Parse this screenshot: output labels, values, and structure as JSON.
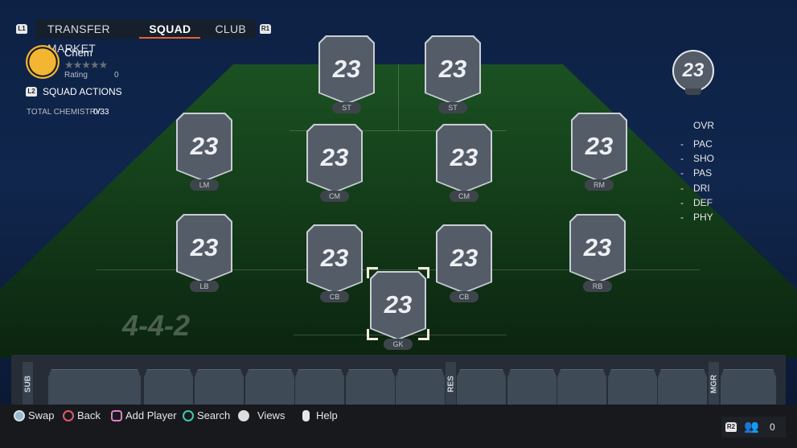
{
  "tabs": {
    "l_button": "L1",
    "r_button": "R1",
    "items": [
      {
        "label": "TRANSFER MARKET"
      },
      {
        "label": "SQUAD",
        "active": true
      },
      {
        "label": "CLUB"
      }
    ]
  },
  "club": {
    "crest": "Kaizer Chiefs",
    "chem_label": "Chem",
    "stars": 0,
    "max_stars": 5,
    "rating_label": "Rating",
    "rating_value": "0"
  },
  "squad_actions": {
    "button": "L2",
    "label": "SQUAD ACTIONS"
  },
  "total_chemistry": {
    "label": "TOTAL CHEMISTRY",
    "value": "0/33"
  },
  "formation": "4-4-2",
  "players": [
    {
      "pos": "ST",
      "rating": "23"
    },
    {
      "pos": "ST",
      "rating": "23"
    },
    {
      "pos": "LM",
      "rating": "23"
    },
    {
      "pos": "CM",
      "rating": "23"
    },
    {
      "pos": "CM",
      "rating": "23"
    },
    {
      "pos": "RM",
      "rating": "23"
    },
    {
      "pos": "LB",
      "rating": "23"
    },
    {
      "pos": "CB",
      "rating": "23"
    },
    {
      "pos": "CB",
      "rating": "23"
    },
    {
      "pos": "RB",
      "rating": "23"
    },
    {
      "pos": "GK",
      "rating": "23",
      "selected": true
    }
  ],
  "team_rating": "23",
  "stats": [
    {
      "label": "OVR",
      "value": ""
    },
    {
      "label": "PAC",
      "value": "-"
    },
    {
      "label": "SHO",
      "value": "-"
    },
    {
      "label": "PAS",
      "value": "-"
    },
    {
      "label": "DRI",
      "value": "-"
    },
    {
      "label": "DEF",
      "value": "-"
    },
    {
      "label": "PHY",
      "value": "-"
    }
  ],
  "bench": {
    "sub_label": "SUB",
    "res_label": "RES",
    "mgr_label": "MGR"
  },
  "hints": [
    {
      "label": "Swap",
      "icon": "cross"
    },
    {
      "label": "Back",
      "icon": "circle"
    },
    {
      "label": "Add Player",
      "icon": "square"
    },
    {
      "label": "Search",
      "icon": "triangle"
    },
    {
      "label": "Views",
      "icon": "right-stick"
    },
    {
      "label": "Help",
      "icon": "options"
    }
  ],
  "friends": {
    "button": "R2",
    "count": "0"
  },
  "colors": {
    "accent": "#e8642c",
    "card": "#545c68",
    "bench": "#262d36"
  }
}
